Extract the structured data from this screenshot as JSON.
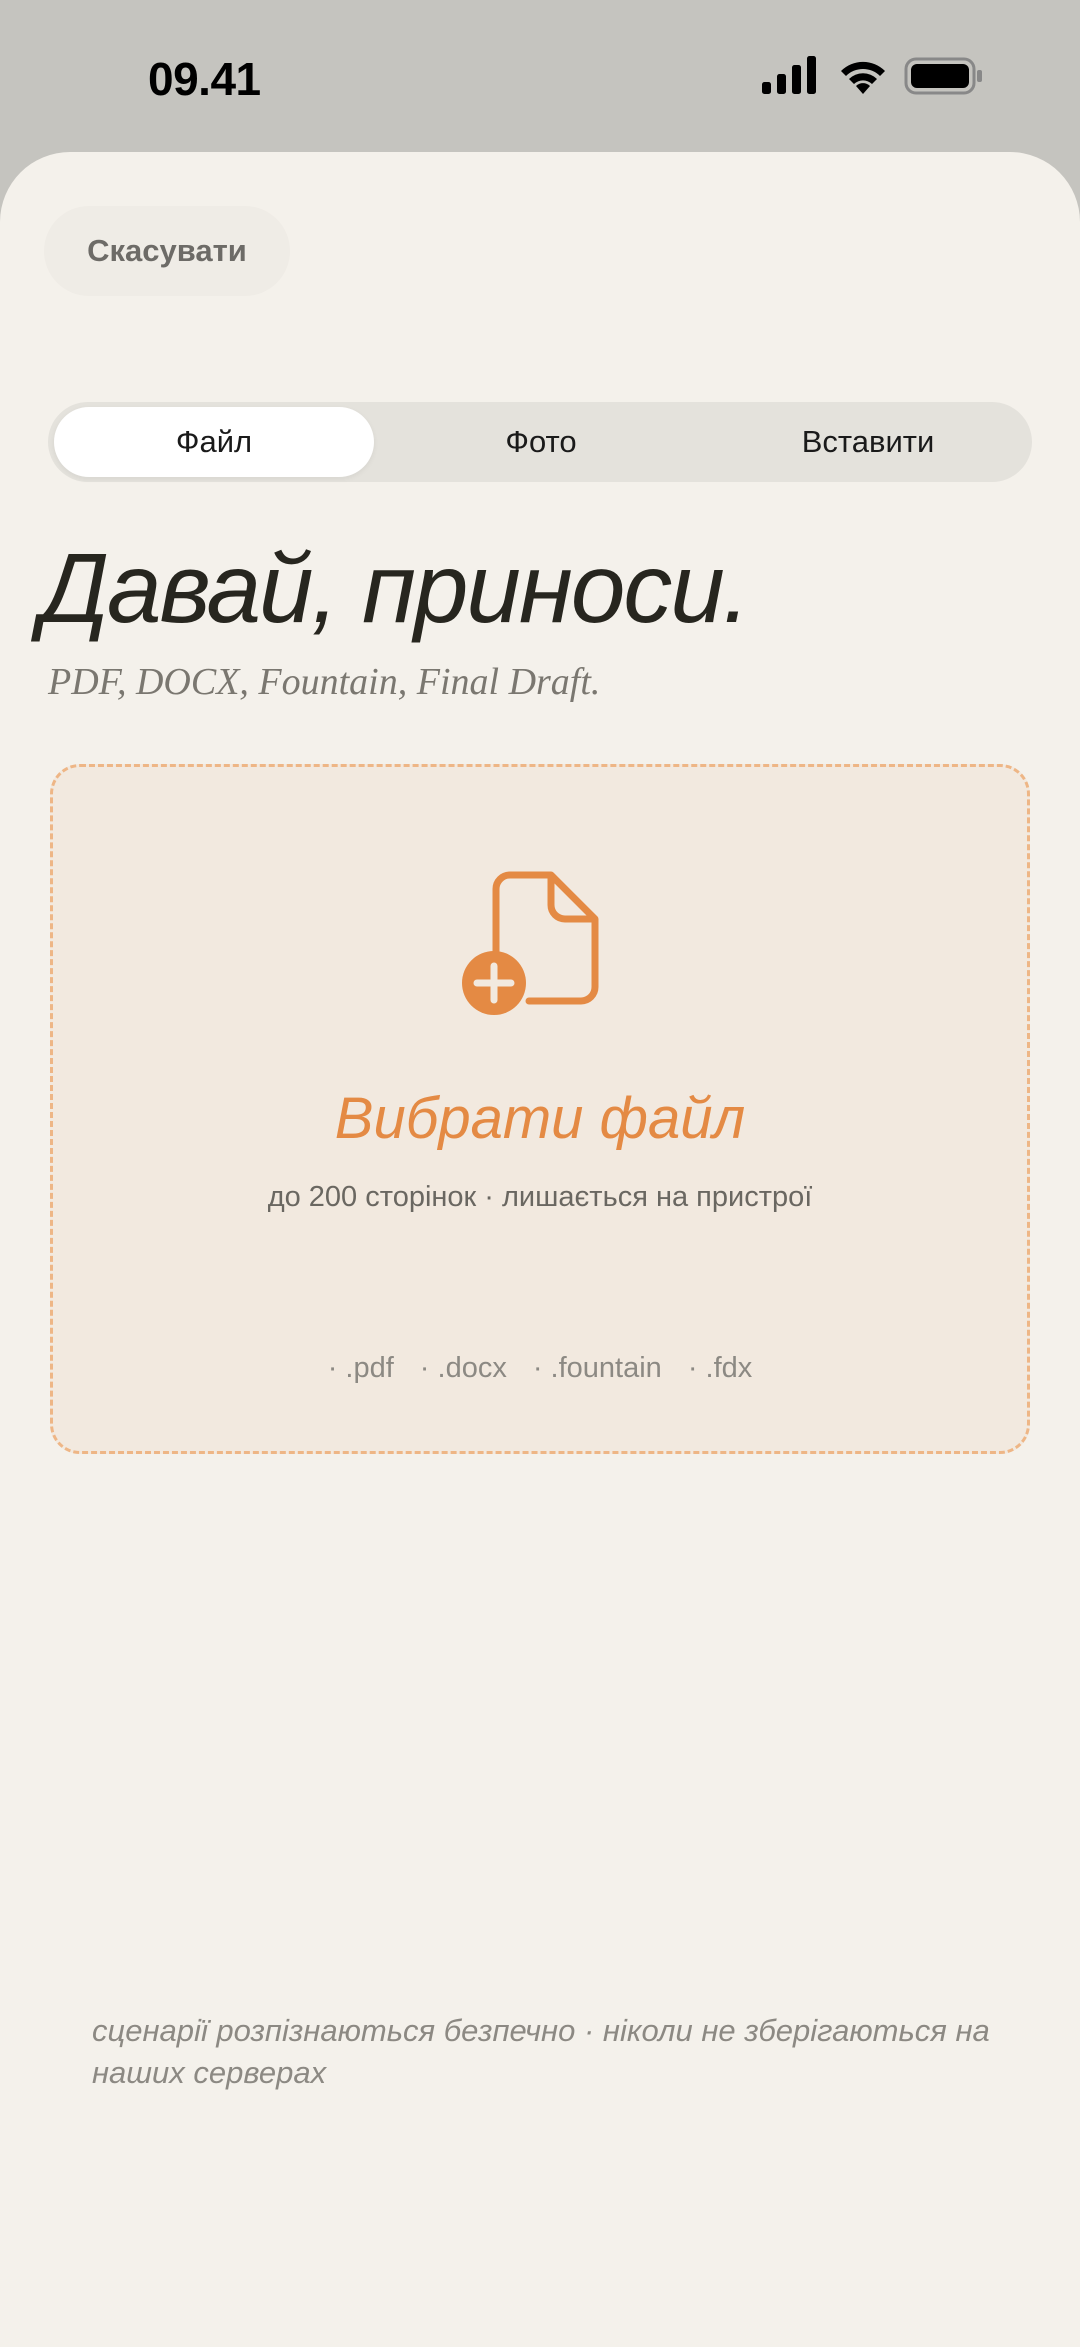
{
  "status_bar": {
    "time": "09.41",
    "icons": [
      "cellular-signal-icon",
      "wifi-icon",
      "battery-icon"
    ]
  },
  "header": {
    "cancel_label": "Скасувати"
  },
  "tabs": [
    {
      "label": "Файл",
      "active": true
    },
    {
      "label": "Фото",
      "active": false
    },
    {
      "label": "Вставити",
      "active": false
    }
  ],
  "headline": "Давай, приноси.",
  "subheadline": "PDF, DOCX, Fountain, Final Draft.",
  "dropzone": {
    "icon": "file-add-icon",
    "title": "Вибрати файл",
    "subtitle": "до 200 сторінок · лишається на пристрої"
  },
  "extensions": [
    "· .pdf",
    "· .docx",
    "· .fountain",
    "· .fdx"
  ],
  "footer": "сценарії розпізнаються безпечно · ніколи не зберігаються на наших серверах",
  "colors": {
    "accent": "#e48a44",
    "sheet_bg": "#f4f1eb",
    "dropzone_bg": "#f2e9df",
    "dropzone_border": "#eeb686"
  }
}
